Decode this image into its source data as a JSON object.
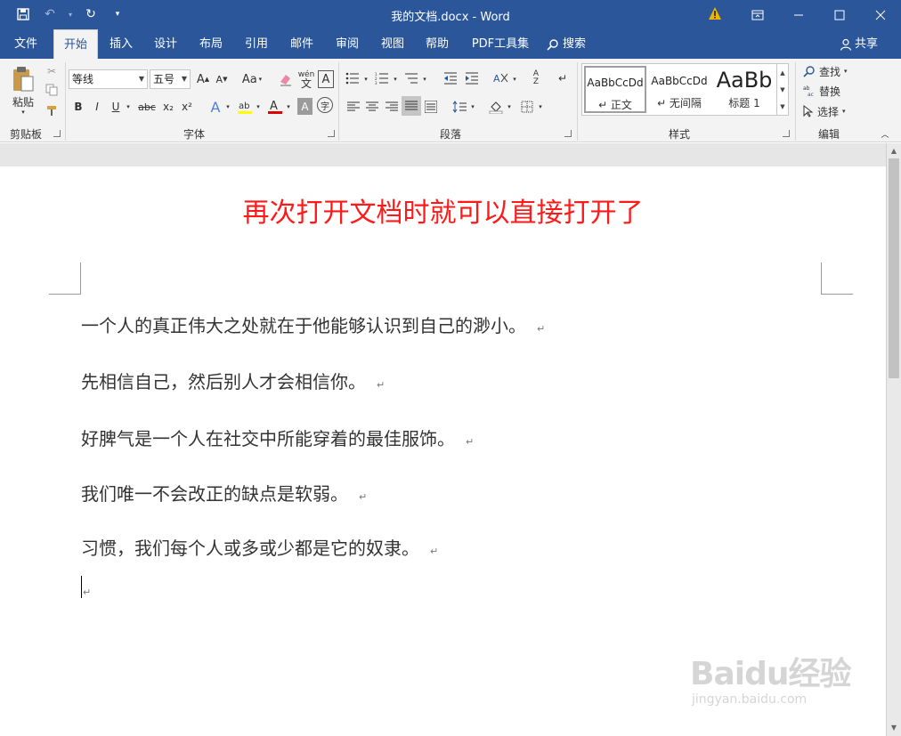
{
  "titlebar": {
    "title": "我的文档.docx - Word",
    "window_controls": [
      "ribbon-display-icon",
      "minimize-icon",
      "maximize-icon",
      "close-icon"
    ]
  },
  "tabs": {
    "items": [
      {
        "label": "文件"
      },
      {
        "label": "开始"
      },
      {
        "label": "插入"
      },
      {
        "label": "设计"
      },
      {
        "label": "布局"
      },
      {
        "label": "引用"
      },
      {
        "label": "邮件"
      },
      {
        "label": "审阅"
      },
      {
        "label": "视图"
      },
      {
        "label": "帮助"
      },
      {
        "label": "PDF工具集"
      }
    ],
    "active": "开始",
    "search_label": "搜索",
    "share_label": "共享"
  },
  "ribbon": {
    "clipboard": {
      "paste_label": "粘贴",
      "group_label": "剪贴板"
    },
    "font": {
      "font_name": "等线",
      "font_size": "五号",
      "change_case": "Aa",
      "phonetic": "wén",
      "bold": "B",
      "italic": "I",
      "underline": "U",
      "strikethrough": "abc",
      "subscript": "x₂",
      "superscript": "x²",
      "text_effect": "A",
      "font_color": "A",
      "char_shading": "A",
      "enclose": "字",
      "group_label": "字体"
    },
    "paragraph": {
      "group_label": "段落"
    },
    "styles": {
      "items": [
        {
          "preview": "AaBbCcDd",
          "name": "↵ 正文"
        },
        {
          "preview": "AaBbCcDd",
          "name": "↵ 无间隔"
        },
        {
          "preview": "AaBb",
          "name": "标题 1"
        }
      ],
      "group_label": "样式"
    },
    "editing": {
      "find": "查找",
      "replace": "替换",
      "select": "选择",
      "group_label": "编辑"
    }
  },
  "document": {
    "overlay_title": "再次打开文档时就可以直接打开了",
    "paragraphs": [
      "一个人的真正伟大之处就在于他能够认识到自己的渺小。",
      "先相信自己，然后别人才会相信你。",
      "好脾气是一个人在社交中所能穿着的最佳服饰。",
      "我们唯一不会改正的缺点是软弱。",
      "习惯，我们每个人或多或少都是它的奴隶。"
    ],
    "paragraph_mark": "↵"
  },
  "watermark": {
    "brand": "Baidu经验",
    "url": "jingyan.baidu.com"
  }
}
